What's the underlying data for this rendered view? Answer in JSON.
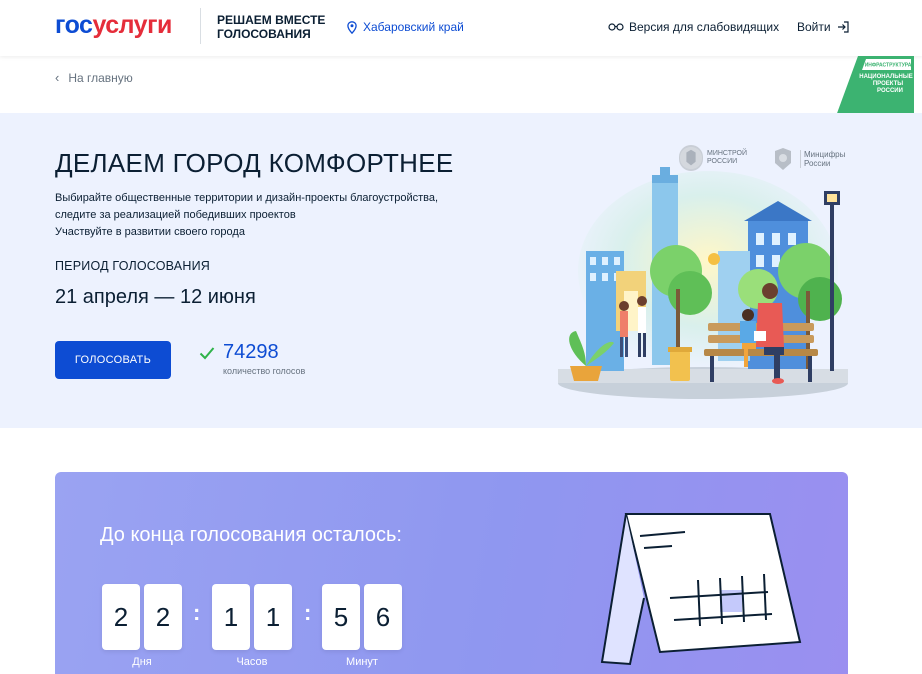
{
  "header": {
    "logo_part1": "гос",
    "logo_part2": "услуги",
    "project_title": "РЕШАЕМ ВМЕСТЕ ГОЛОСОВАНИЯ",
    "region": "Хабаровский край",
    "accessibility": "Версия для слабовидящих",
    "login": "Войти"
  },
  "breadcrumb": {
    "home": "На главную"
  },
  "badge": {
    "line1": "ИНФРАСТРУКТУРА",
    "line2": "НАЦИОНАЛЬНЫЕ",
    "line3": "ПРОЕКТЫ",
    "line4": "РОССИИ"
  },
  "hero": {
    "title": "ДЕЛАЕМ ГОРОД КОМФОРТНЕЕ",
    "desc_line1": "Выбирайте общественные территории и дизайн-проекты благоустройства,",
    "desc_line2": "следите за реализацией победивших проектов",
    "desc_line3": "Участвуйте в развитии своего города",
    "period_label": "ПЕРИОД ГОЛОСОВАНИЯ",
    "period_dates": "21 апреля — 12 июня",
    "vote_button": "ГОЛОСОВАТЬ",
    "vote_count": "74298",
    "vote_count_label": "количество голосов",
    "ministry1_line1": "МИНСТРОЙ",
    "ministry1_line2": "РОССИИ",
    "ministry2_line1": "Минцифры",
    "ministry2_line2": "России"
  },
  "timer": {
    "title": "До конца голосования осталось:",
    "days": [
      "2",
      "2"
    ],
    "hours": [
      "1",
      "1"
    ],
    "minutes": [
      "5",
      "6"
    ],
    "days_label": "Дня",
    "hours_label": "Часов",
    "minutes_label": "Минут"
  },
  "colors": {
    "brand_blue": "#0d4cd3",
    "brand_red": "#e52d3a",
    "hero_bg": "#edf2fe",
    "timer_bg": "#9aa3f2",
    "badge_green": "#3cb371"
  }
}
